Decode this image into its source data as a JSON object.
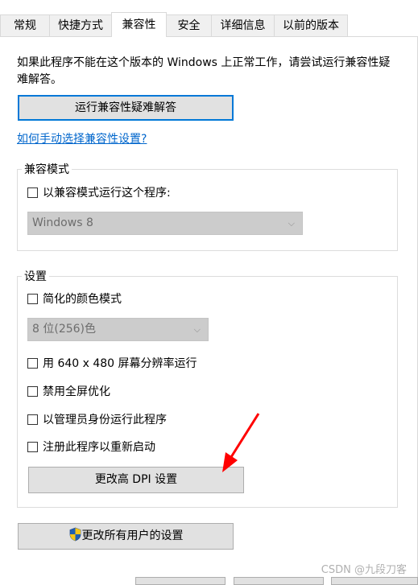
{
  "tabs": [
    {
      "label": "常规"
    },
    {
      "label": "快捷方式"
    },
    {
      "label": "兼容性"
    },
    {
      "label": "安全"
    },
    {
      "label": "详细信息"
    },
    {
      "label": "以前的版本"
    }
  ],
  "compat": {
    "description": "如果此程序不能在这个版本的 Windows 上正常工作，请尝试运行兼容性疑难解答。",
    "troubleshooter_button": "运行兼容性疑难解答",
    "manual_link": "如何手动选择兼容性设置?",
    "mode_group": {
      "legend": "兼容模式",
      "checkbox_label": "以兼容模式运行这个程序:",
      "os_select_value": "Windows 8"
    },
    "settings_group": {
      "legend": "设置",
      "reduced_color": "简化的颜色模式",
      "color_select_value": "8 位(256)色",
      "res_640": "用 640 x 480 屏幕分辨率运行",
      "disable_fullscreen_opt": "禁用全屏优化",
      "run_as_admin": "以管理员身份运行此程序",
      "register_restart": "注册此程序以重新启动",
      "dpi_button": "更改高 DPI 设置"
    },
    "all_users_button": "更改所有用户的设置"
  },
  "watermark": "CSDN @九段刀客",
  "colors": {
    "accent": "#0078d7",
    "annotation_arrow": "#ff0000",
    "link": "#0066cc"
  },
  "icons": {
    "all_users": "uac-shield-icon",
    "dropdown": "chevron-down-icon",
    "annotation": "red-arrow"
  }
}
